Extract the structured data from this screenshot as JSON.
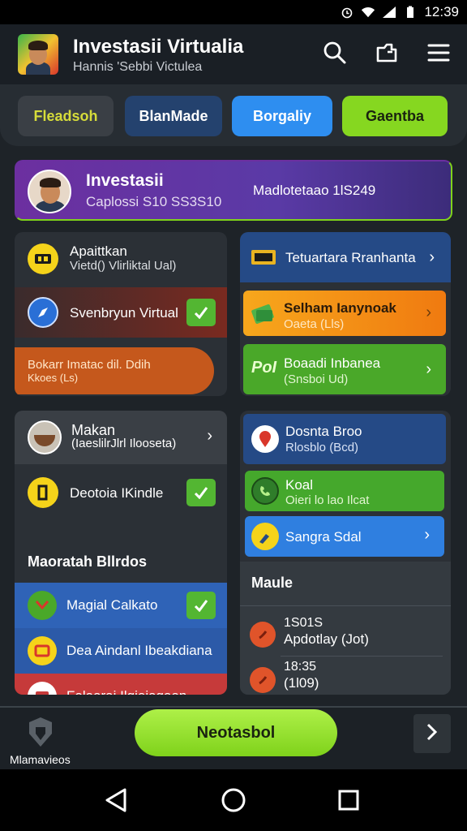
{
  "status_bar": {
    "time": "12:39"
  },
  "header": {
    "title": "Investasii Virtualia",
    "subtitle": "Hannis 'Sebbi Victulea"
  },
  "chips": [
    {
      "label": "Fleadsoh",
      "color": "#3a3f45",
      "text_color": "#d6dc3a"
    },
    {
      "label": "BlanMade",
      "color": "#24426e",
      "text_color": "#ffffff"
    },
    {
      "label": "Borgaliy",
      "color": "#2e8ef0",
      "text_color": "#ffffff"
    },
    {
      "label": "Gaentba",
      "color": "#86d720",
      "text_color": "#1a2310"
    }
  ],
  "profile_card": {
    "name": "Investasii",
    "detail": "Caplossi S10 SS3S10",
    "right_text": "Madlotetaao 1lS249"
  },
  "left_panel_1": {
    "items": [
      {
        "line1": "Apaittkan",
        "line2": "Vietd() Vlirliktal Ual)",
        "icon": "ticket-icon"
      },
      {
        "line1": "Svenbryun Virtual",
        "line2": "",
        "icon": "compass-icon",
        "checked": true
      },
      {
        "line1": "Bokarr Imatac dil. Ddih",
        "line2": "Kkoes (Ls)",
        "icon": ""
      }
    ]
  },
  "right_panel_1": {
    "items": [
      {
        "line1": "Tetuartara Rranhanta",
        "line2": "",
        "icon": "ticket-icon"
      },
      {
        "line1": "Selham Ianynoak",
        "line2": "Oaeta (Lls)",
        "icon": "money-icon"
      },
      {
        "line1": "Boaadi Inbanea",
        "line2": "(Snsboi Ud)",
        "icon_text": "PoI"
      }
    ]
  },
  "left_panel_2": {
    "items": [
      {
        "line1": "Makan",
        "line2": "(IaeslilrJlrl Ilooseta)",
        "icon": "food-icon"
      },
      {
        "line1": "Deotoia IKindle",
        "line2": "",
        "icon": "tag-icon",
        "checked": true
      }
    ],
    "section_title": "Maoratah Bllrdos",
    "colored_items": [
      {
        "line1": "Magial Calkato",
        "icon": "check-circle-icon",
        "checked": true
      },
      {
        "line1": "Dea Aindanl Ibeakdiana",
        "icon": "ticket-icon"
      },
      {
        "line1": "Folaarai Ilgieiagaan",
        "icon": "ticket-icon"
      }
    ]
  },
  "right_panel_2": {
    "items": [
      {
        "line1": "Dosnta Broo",
        "line2": "Rlosblo (Bcd)",
        "icon": "pin-icon"
      },
      {
        "line1": "Koal",
        "line2": "Oieri lo lao Ilcat",
        "icon": "phone-icon"
      },
      {
        "line1": "Sangra Sdal",
        "line2": "",
        "icon": "paint-icon"
      }
    ],
    "section_title": "Maule",
    "events": [
      {
        "time": "1S01S",
        "desc": "Apdotlay (Jot)"
      },
      {
        "time": "18:35",
        "desc": "(1l09)"
      }
    ]
  },
  "bottom_bar": {
    "left_label": "Mlamavieos",
    "cta_label": "Neotasbol"
  }
}
